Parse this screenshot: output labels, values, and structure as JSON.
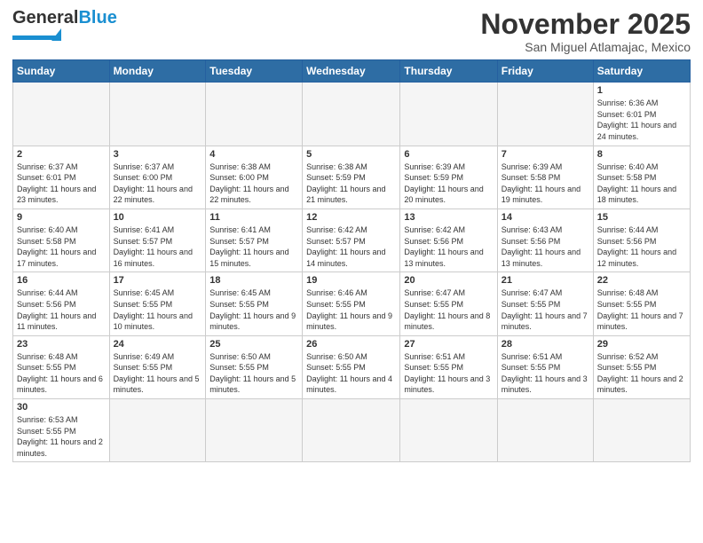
{
  "header": {
    "logo_general": "General",
    "logo_blue": "Blue",
    "month_title": "November 2025",
    "location": "San Miguel Atlamajac, Mexico"
  },
  "days_of_week": [
    "Sunday",
    "Monday",
    "Tuesday",
    "Wednesday",
    "Thursday",
    "Friday",
    "Saturday"
  ],
  "weeks": [
    [
      {
        "day": "",
        "empty": true
      },
      {
        "day": "",
        "empty": true
      },
      {
        "day": "",
        "empty": true
      },
      {
        "day": "",
        "empty": true
      },
      {
        "day": "",
        "empty": true
      },
      {
        "day": "",
        "empty": true
      },
      {
        "day": "1",
        "sunrise": "6:36 AM",
        "sunset": "6:01 PM",
        "daylight": "11 hours and 24 minutes."
      }
    ],
    [
      {
        "day": "2",
        "sunrise": "6:37 AM",
        "sunset": "6:01 PM",
        "daylight": "11 hours and 23 minutes."
      },
      {
        "day": "3",
        "sunrise": "6:37 AM",
        "sunset": "6:00 PM",
        "daylight": "11 hours and 22 minutes."
      },
      {
        "day": "4",
        "sunrise": "6:38 AM",
        "sunset": "6:00 PM",
        "daylight": "11 hours and 22 minutes."
      },
      {
        "day": "5",
        "sunrise": "6:38 AM",
        "sunset": "5:59 PM",
        "daylight": "11 hours and 21 minutes."
      },
      {
        "day": "6",
        "sunrise": "6:39 AM",
        "sunset": "5:59 PM",
        "daylight": "11 hours and 20 minutes."
      },
      {
        "day": "7",
        "sunrise": "6:39 AM",
        "sunset": "5:58 PM",
        "daylight": "11 hours and 19 minutes."
      },
      {
        "day": "8",
        "sunrise": "6:40 AM",
        "sunset": "5:58 PM",
        "daylight": "11 hours and 18 minutes."
      }
    ],
    [
      {
        "day": "9",
        "sunrise": "6:40 AM",
        "sunset": "5:58 PM",
        "daylight": "11 hours and 17 minutes."
      },
      {
        "day": "10",
        "sunrise": "6:41 AM",
        "sunset": "5:57 PM",
        "daylight": "11 hours and 16 minutes."
      },
      {
        "day": "11",
        "sunrise": "6:41 AM",
        "sunset": "5:57 PM",
        "daylight": "11 hours and 15 minutes."
      },
      {
        "day": "12",
        "sunrise": "6:42 AM",
        "sunset": "5:57 PM",
        "daylight": "11 hours and 14 minutes."
      },
      {
        "day": "13",
        "sunrise": "6:42 AM",
        "sunset": "5:56 PM",
        "daylight": "11 hours and 13 minutes."
      },
      {
        "day": "14",
        "sunrise": "6:43 AM",
        "sunset": "5:56 PM",
        "daylight": "11 hours and 13 minutes."
      },
      {
        "day": "15",
        "sunrise": "6:44 AM",
        "sunset": "5:56 PM",
        "daylight": "11 hours and 12 minutes."
      }
    ],
    [
      {
        "day": "16",
        "sunrise": "6:44 AM",
        "sunset": "5:56 PM",
        "daylight": "11 hours and 11 minutes."
      },
      {
        "day": "17",
        "sunrise": "6:45 AM",
        "sunset": "5:55 PM",
        "daylight": "11 hours and 10 minutes."
      },
      {
        "day": "18",
        "sunrise": "6:45 AM",
        "sunset": "5:55 PM",
        "daylight": "11 hours and 9 minutes."
      },
      {
        "day": "19",
        "sunrise": "6:46 AM",
        "sunset": "5:55 PM",
        "daylight": "11 hours and 9 minutes."
      },
      {
        "day": "20",
        "sunrise": "6:47 AM",
        "sunset": "5:55 PM",
        "daylight": "11 hours and 8 minutes."
      },
      {
        "day": "21",
        "sunrise": "6:47 AM",
        "sunset": "5:55 PM",
        "daylight": "11 hours and 7 minutes."
      },
      {
        "day": "22",
        "sunrise": "6:48 AM",
        "sunset": "5:55 PM",
        "daylight": "11 hours and 7 minutes."
      }
    ],
    [
      {
        "day": "23",
        "sunrise": "6:48 AM",
        "sunset": "5:55 PM",
        "daylight": "11 hours and 6 minutes."
      },
      {
        "day": "24",
        "sunrise": "6:49 AM",
        "sunset": "5:55 PM",
        "daylight": "11 hours and 5 minutes."
      },
      {
        "day": "25",
        "sunrise": "6:50 AM",
        "sunset": "5:55 PM",
        "daylight": "11 hours and 5 minutes."
      },
      {
        "day": "26",
        "sunrise": "6:50 AM",
        "sunset": "5:55 PM",
        "daylight": "11 hours and 4 minutes."
      },
      {
        "day": "27",
        "sunrise": "6:51 AM",
        "sunset": "5:55 PM",
        "daylight": "11 hours and 3 minutes."
      },
      {
        "day": "28",
        "sunrise": "6:51 AM",
        "sunset": "5:55 PM",
        "daylight": "11 hours and 3 minutes."
      },
      {
        "day": "29",
        "sunrise": "6:52 AM",
        "sunset": "5:55 PM",
        "daylight": "11 hours and 2 minutes."
      }
    ],
    [
      {
        "day": "30",
        "sunrise": "6:53 AM",
        "sunset": "5:55 PM",
        "daylight": "11 hours and 2 minutes."
      },
      {
        "day": "",
        "empty": true
      },
      {
        "day": "",
        "empty": true
      },
      {
        "day": "",
        "empty": true
      },
      {
        "day": "",
        "empty": true
      },
      {
        "day": "",
        "empty": true
      },
      {
        "day": "",
        "empty": true
      }
    ]
  ],
  "labels": {
    "sunrise": "Sunrise:",
    "sunset": "Sunset:",
    "daylight": "Daylight:"
  }
}
